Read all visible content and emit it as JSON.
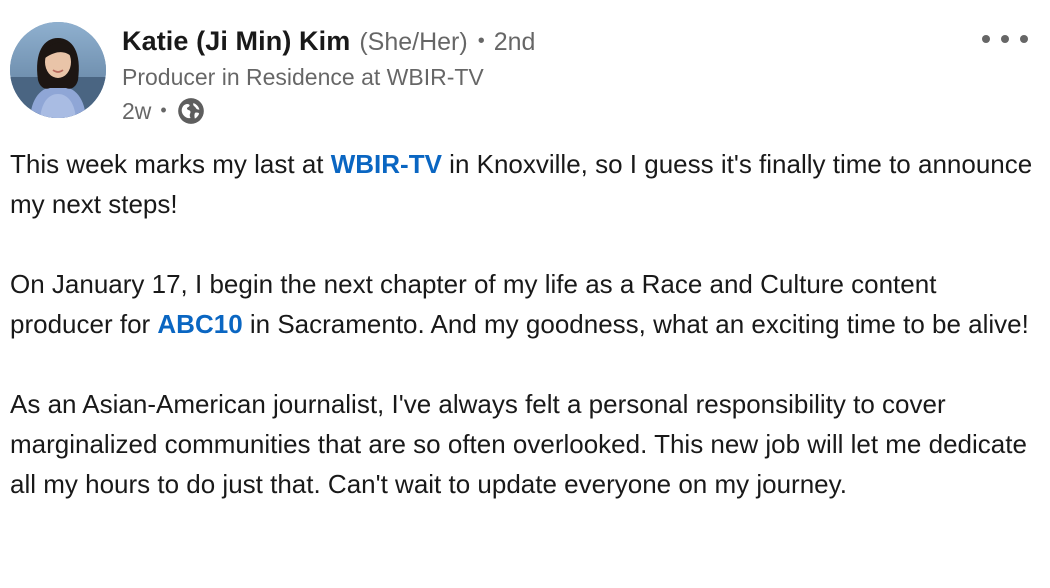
{
  "author": {
    "name": "Katie (Ji Min) Kim",
    "pronouns": "(She/Her)",
    "separator": "•",
    "degree": "2nd",
    "headline": "Producer in Residence at WBIR-TV",
    "time_ago": "2w",
    "visibility_icon": "globe-icon"
  },
  "more_icon": "more-horizontal-icon",
  "post": {
    "p1": {
      "before": "This week marks my last at ",
      "mention": "WBIR-TV",
      "after": " in Knoxville, so I guess it's finally time to announce my next steps!"
    },
    "p2": {
      "before": "On January 17, I begin the next chapter of my life as a Race and Culture content producer for ",
      "mention": "ABC10",
      "after": " in Sacramento. And my goodness, what an exciting time to be alive!"
    },
    "p3": "As an Asian-American journalist, I've always felt a personal responsibility to cover marginalized communities that are so often overlooked. This new job will let me dedicate all my hours to do just that. Can't wait to update everyone on my journey."
  },
  "colors": {
    "mention_blue": "#0a66c2",
    "muted_text": "#666666"
  }
}
